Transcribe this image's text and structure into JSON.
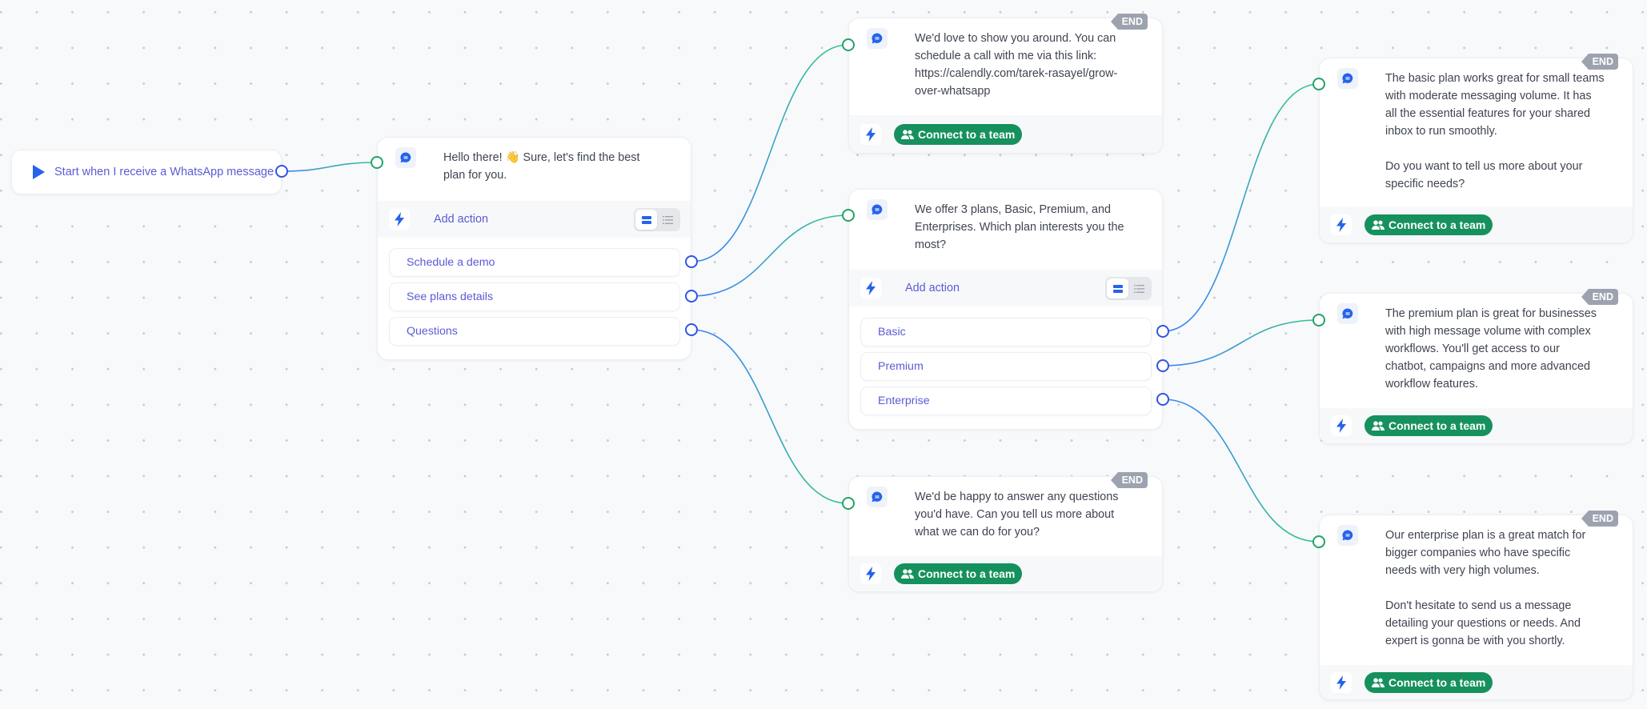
{
  "canvas": {
    "colors": {
      "accent": "#2563eb",
      "link_text": "#5b5bd6",
      "success": "#16915d",
      "end_badge": "#9ca3af",
      "edge_start": "#3b82f6",
      "edge_end": "#34c38f"
    }
  },
  "trigger": {
    "icon": "play-icon",
    "label": "Start when I receive a WhatsApp message"
  },
  "nodes": {
    "greeting": {
      "icon": "chat-bubble-icon",
      "message": "Hello there! 👋 Sure, let's find the best\nplan for you.",
      "add_action_label": "Add action",
      "options": [
        "Schedule a demo",
        "See plans details",
        "Questions"
      ]
    },
    "demo": {
      "icon": "chat-bubble-icon",
      "message": "We'd love to show you around. You can\nschedule a call with me via this link:\nhttps://calendly.com/tarek-rasayel/grow-\nover-whatsapp",
      "end_label": "END",
      "action_label": "Connect to a team"
    },
    "plans": {
      "icon": "chat-bubble-icon",
      "message": "We offer 3 plans, Basic, Premium, and\nEnterprises. Which plan interests you the\nmost?",
      "add_action_label": "Add action",
      "options": [
        "Basic",
        "Premium",
        "Enterprise"
      ]
    },
    "questions": {
      "icon": "chat-bubble-icon",
      "message": "We'd be happy to answer any questions\nyou'd have. Can you tell us more about\nwhat we can do for you?",
      "end_label": "END",
      "action_label": "Connect to a team"
    },
    "basic": {
      "icon": "chat-bubble-icon",
      "message": "The basic plan works great for small teams\nwith moderate messaging volume. It has\nall the essential features for your shared\ninbox to run smoothly.\n\nDo you want to tell us more about your\nspecific needs?",
      "end_label": "END",
      "action_label": "Connect to a team"
    },
    "premium": {
      "icon": "chat-bubble-icon",
      "message": "The premium plan is great for businesses\nwith high message volume with complex\nworkflows. You'll get access to our\nchatbot, campaigns and more advanced\nworkflow features.",
      "end_label": "END",
      "action_label": "Connect to a team"
    },
    "enterprise": {
      "icon": "chat-bubble-icon",
      "message": "Our enterprise plan is a great match for\nbigger companies who have specific\nneeds with very high volumes.\n\nDon't hesitate to send us a message\ndetailing your questions or needs. And\nexpert is gonna be with you shortly.",
      "end_label": "END",
      "action_label": "Connect to a team"
    }
  },
  "edges": [
    {
      "from": "trigger",
      "to": "greeting"
    },
    {
      "from": "Schedule a demo",
      "to": "demo"
    },
    {
      "from": "See plans details",
      "to": "plans"
    },
    {
      "from": "Questions",
      "to": "questions"
    },
    {
      "from": "Basic",
      "to": "basic"
    },
    {
      "from": "Premium",
      "to": "premium"
    },
    {
      "from": "Enterprise",
      "to": "enterprise"
    }
  ]
}
